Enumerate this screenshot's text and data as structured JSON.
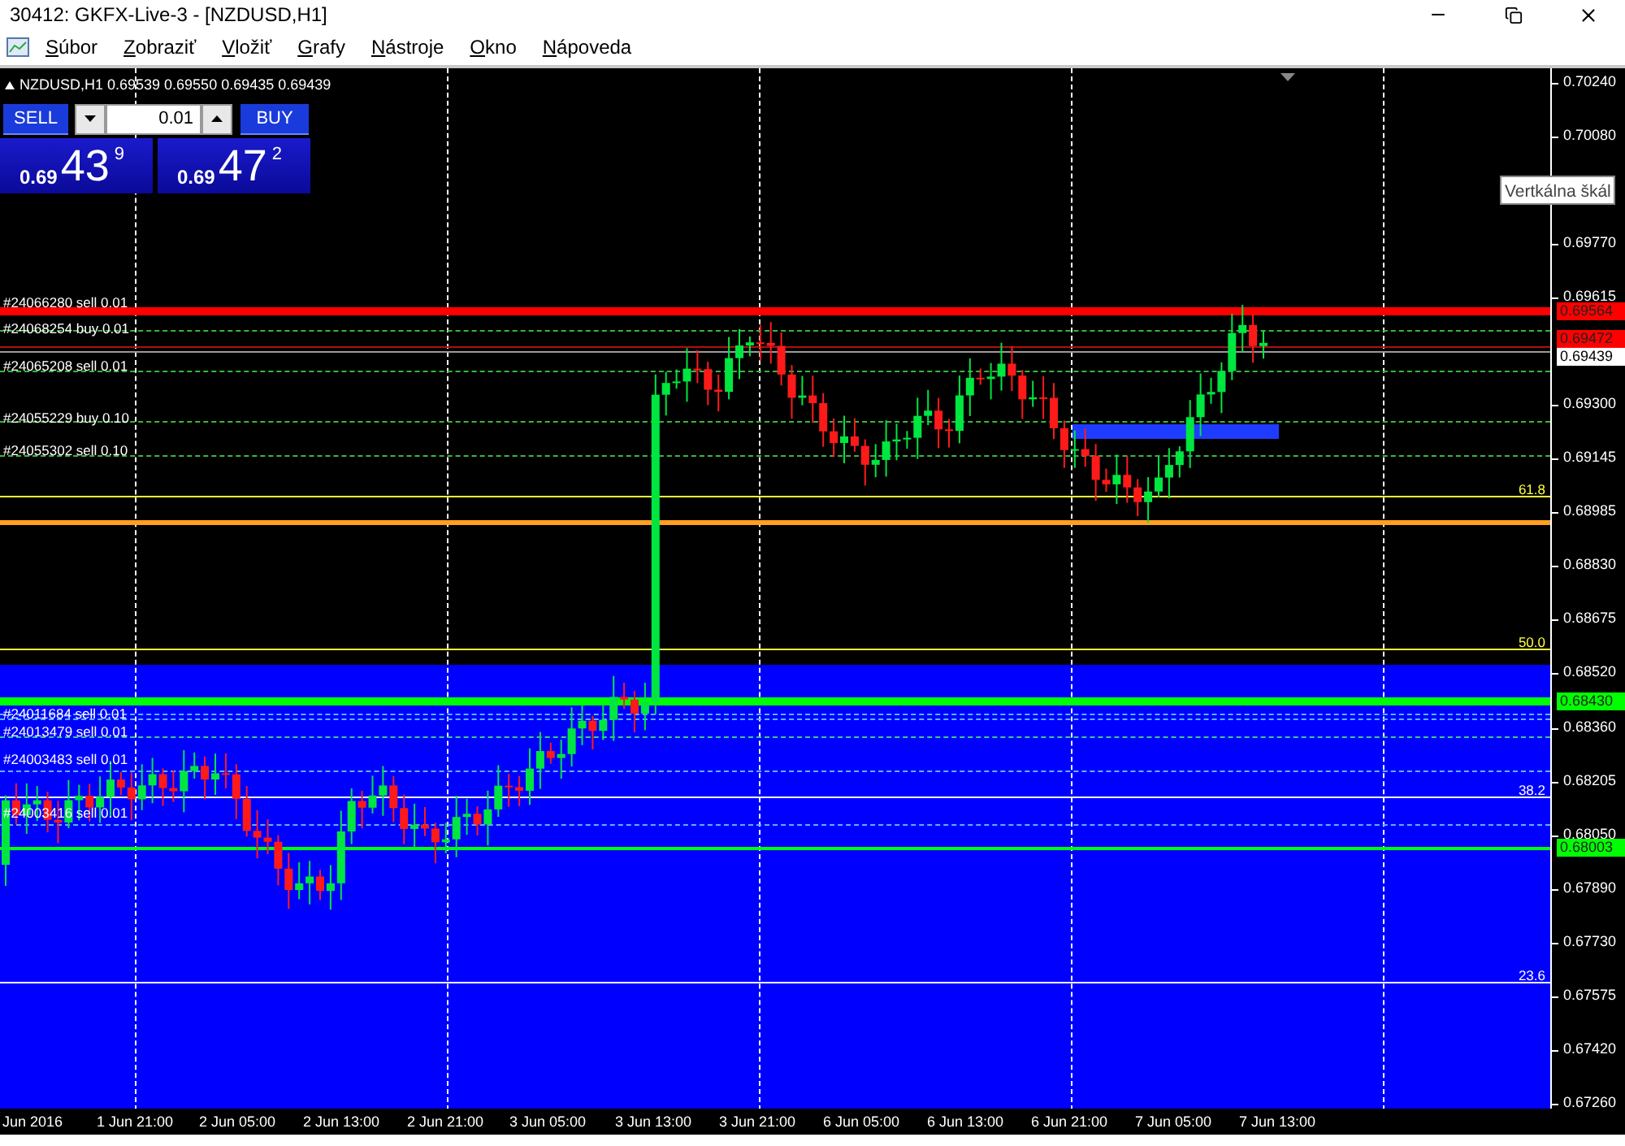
{
  "window": {
    "title": "30412: GKFX-Live-3 - [NZDUSD,H1]"
  },
  "menu": [
    "Súbor",
    "Zobraziť",
    "Vložiť",
    "Grafy",
    "Nástroje",
    "Okno",
    "Nápoveda"
  ],
  "chart": {
    "header": "NZDUSD,H1  0.69539 0.69550 0.69435 0.69439",
    "trade_panel": {
      "sell_label": "SELL",
      "buy_label": "BUY",
      "lot": "0.01",
      "sell_price": {
        "prefix": "0.69",
        "big": "43",
        "small": "9"
      },
      "buy_price": {
        "prefix": "0.69",
        "big": "47",
        "small": "2"
      }
    },
    "order_labels": [
      "#24066280 sell 0.01",
      "#24068254 buy 0.01",
      "#24065208 sell 0.01",
      "#24055229 buy 0.10",
      "#24055302 sell 0.10",
      "#24011684 sell 0.01",
      "#24013479 sell 0.01",
      "#24003483 sell 0.01",
      "#24003416 sell 0.01"
    ],
    "fib_levels": [
      {
        "label": "61.8",
        "color": "#ffff40"
      },
      {
        "label": "50.0",
        "color": "#ffff40"
      },
      {
        "label": "38.2",
        "color": "#ffffff"
      },
      {
        "label": "23.6",
        "color": "#ffffff"
      }
    ],
    "price_axis": [
      "0.70240",
      "0.70080",
      "0.69770",
      "0.69615",
      "0.69300",
      "0.69145",
      "0.68985",
      "0.68830",
      "0.68675",
      "0.68520",
      "0.68360",
      "0.68205",
      "0.68050",
      "0.67890",
      "0.67730",
      "0.67575",
      "0.67420",
      "0.67260"
    ],
    "price_tags": [
      {
        "text": "0.69564",
        "color": "#ff0000"
      },
      {
        "text": "0.69472",
        "color": "#ff0000"
      },
      {
        "text": "0.69439",
        "color": "#ffffff"
      },
      {
        "text": "0.68430",
        "color": "#00ff00"
      },
      {
        "text": "0.68003",
        "color": "#00ff00"
      }
    ],
    "time_axis": [
      "Jun 2016",
      "1 Jun 21:00",
      "2 Jun 05:00",
      "2 Jun 13:00",
      "2 Jun 21:00",
      "3 Jun 05:00",
      "3 Jun 13:00",
      "3 Jun 21:00",
      "6 Jun 05:00",
      "6 Jun 13:00",
      "6 Jun 21:00",
      "7 Jun 05:00",
      "7 Jun 13:00"
    ],
    "tooltip": "Vertkálna škál"
  }
}
